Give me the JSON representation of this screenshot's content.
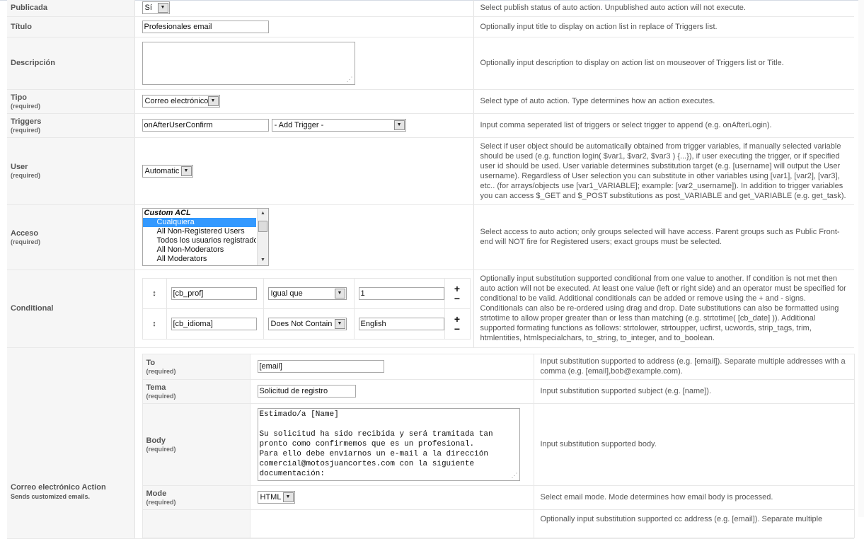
{
  "rows": {
    "published": {
      "label": "Publicada",
      "value": "Sí",
      "desc": "Select publish status of auto action. Unpublished auto action will not execute."
    },
    "title": {
      "label": "Título",
      "value": "Profesionales email",
      "desc": "Optionally input title to display on action list in replace of Triggers list."
    },
    "description": {
      "label": "Descripción",
      "value": "",
      "desc": "Optionally input description to display on action list on mouseover of Triggers list or Title."
    },
    "type": {
      "label": "Tipo",
      "required": "(required)",
      "value": "Correo electrónico",
      "desc": "Select type of auto action. Type determines how an action executes."
    },
    "triggers": {
      "label": "Triggers",
      "required": "(required)",
      "value": "onAfterUserConfirm",
      "add_trigger": "- Add Trigger -",
      "desc": "Input comma seperated list of triggers or select trigger to append (e.g. onAfterLogin)."
    },
    "user": {
      "label": "User",
      "required": "(required)",
      "value": "Automatic",
      "desc": "Select if user object should be automatically obtained from trigger variables, if manually selected variable should be used (e.g. function login( $var1, $var2, $var3 ) {...}), if user executing the trigger, or if specified user id should be used. User variable determines substitution target (e.g. [username] will output the User username). Regardless of User selection you can substitute in other variables using [var1], [var2], [var3], etc.. (for arrays/objects use [var1_VARIABLE]; example: [var2_username]). In addition to trigger variables you can access $_GET and $_POST substitutions as post_VARIABLE and get_VARIABLE (e.g. get_task)."
    },
    "access": {
      "label": "Acceso",
      "required": "(required)",
      "options": [
        "Custom ACL",
        "Cualquiera",
        "All Non-Registered Users",
        "Todos los usuarios registrados",
        "All Non-Moderators",
        "All Moderators"
      ],
      "desc": "Select access to auto action; only groups selected will have access. Parent groups such as Public Front-end will NOT fire for Registered users; exact groups must be selected."
    },
    "conditional": {
      "label": "Conditional",
      "conditions": [
        {
          "left": "[cb_prof]",
          "op": "Igual que",
          "right": "1"
        },
        {
          "left": "[cb_idioma]",
          "op": "Does Not Contain",
          "right": "English"
        }
      ],
      "desc": "Optionally input substitution supported conditional from one value to another. If condition is not met then auto action will not be executed. At least one value (left or right side) and an operator must be specified for conditional to be valid. Additional conditionals can be added or remove using the + and - signs. Conditionals can also be re-ordered using drag and drop. Date substitutions can also be formatted using strtotime to allow proper greater than or less than matching (e.g. strtotime( [cb_date] )). Additional supported formating functions as follows: strtolower, strtoupper, ucfirst, ucwords, strip_tags, trim, htmlentities, htmlspecialchars, to_string, to_integer, and to_boolean."
    },
    "email_action": {
      "label": "Correo electrónico Action",
      "sublabel": "Sends customized emails.",
      "to": {
        "label": "To",
        "required": "(required)",
        "value": "[email]",
        "desc": "Input substitution supported to address (e.g. [email]). Separate multiple addresses with a comma (e.g. [email],bob@example.com)."
      },
      "subject": {
        "label": "Tema",
        "required": "(required)",
        "value": "Solicitud de registro",
        "desc": "Input substitution supported subject (e.g. [name])."
      },
      "body": {
        "label": "Body",
        "required": "(required)",
        "value": "Estimado/a [Name]\n\nSu solicitud ha sido recibida y será tramitada tan\npronto como confirmemos que es un profesional.\nPara ello debe enviarnos un e-mail a la dirección\ncomercial@motosjuancortes.com con la siguiente\ndocumentación:",
        "desc": "Input substitution supported body."
      },
      "mode": {
        "label": "Mode",
        "required": "(required)",
        "value": "HTML",
        "desc": "Select email mode. Mode determines how email body is processed."
      },
      "next_desc": "Optionally input substitution supported cc address (e.g. [email]). Separate multiple"
    }
  },
  "icons": {
    "drag": "↕",
    "plus": "+",
    "minus": "−",
    "arrow": "▼",
    "up": "▲",
    "grip": "⋰"
  }
}
